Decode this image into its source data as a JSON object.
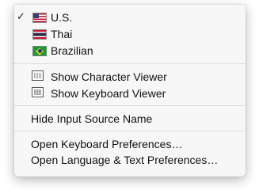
{
  "menu": {
    "input_sources": [
      {
        "label": "U.S.",
        "checked": true,
        "icon": "us-flag-icon"
      },
      {
        "label": "Thai",
        "checked": false,
        "icon": "thai-flag-icon"
      },
      {
        "label": "Brazilian",
        "checked": false,
        "icon": "brazil-flag-icon"
      }
    ],
    "checkmark": "✓",
    "viewers": [
      {
        "label": "Show Character Viewer",
        "icon": "character-viewer-icon"
      },
      {
        "label": "Show Keyboard Viewer",
        "icon": "keyboard-viewer-icon"
      }
    ],
    "hide_source_name_label": "Hide Input Source Name",
    "preferences": [
      {
        "label": "Open Keyboard Preferences…"
      },
      {
        "label": "Open Language & Text Preferences…"
      }
    ]
  }
}
